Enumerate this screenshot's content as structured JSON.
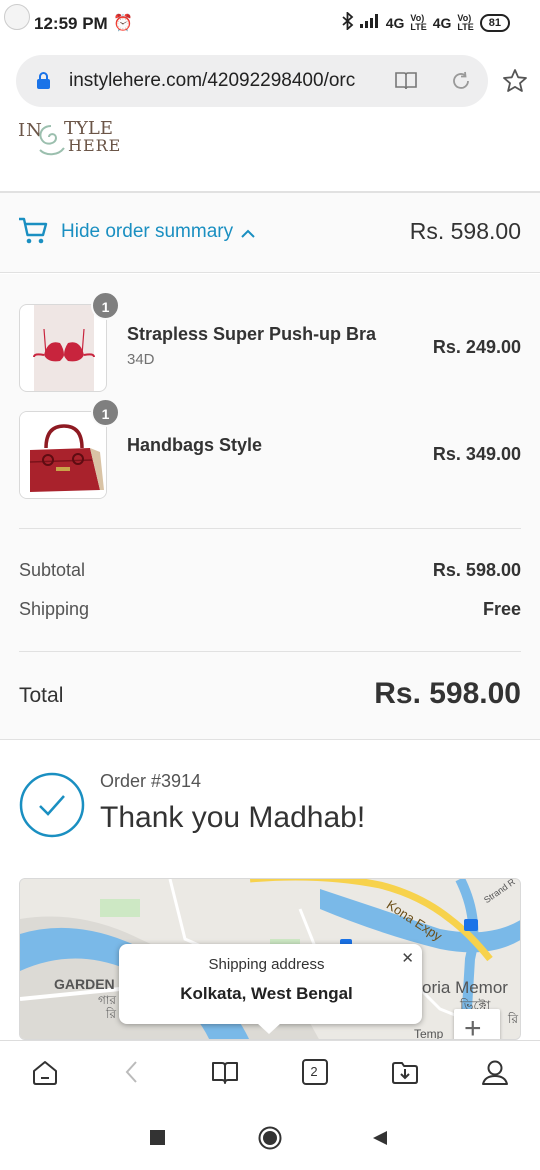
{
  "status_bar": {
    "time": "12:59 PM",
    "network_1": "4G",
    "network_2": "4G",
    "battery": "81"
  },
  "browser": {
    "url": "instylehere.com/42092298400/orc"
  },
  "store": {
    "logo_line1": "IN",
    "logo_line1b": "TYLE",
    "logo_line2": "HERE"
  },
  "order_summary_toggle": {
    "label": "Hide order summary",
    "total": "Rs. 598.00",
    "accent_color": "#1a8fc1"
  },
  "line_items": [
    {
      "name": "Strapless Super Push-up Bra",
      "variant": "34D",
      "price": "Rs. 249.00",
      "quantity": "1"
    },
    {
      "name": "Handbags Style",
      "variant": "",
      "price": "Rs. 349.00",
      "quantity": "1"
    }
  ],
  "totals": {
    "subtotal_label": "Subtotal",
    "subtotal_value": "Rs. 598.00",
    "shipping_label": "Shipping",
    "shipping_value": "Free",
    "total_label": "Total",
    "total_value": "Rs. 598.00"
  },
  "confirmation": {
    "order_number": "Order #3914",
    "thank_you": "Thank you Madhab!"
  },
  "map": {
    "popup_title": "Shipping address",
    "popup_location": "Kolkata, West Bengal",
    "labels": {
      "garden": "GARDEN",
      "garden_local": "গার",
      "garden_local2": "রি",
      "road": "Kona Expy",
      "strand": "Strand R",
      "memorial": "oria Memor",
      "memorial_local": "ভিক্টো",
      "temple": "Temp",
      "temple_local": "রি"
    }
  },
  "bottom_nav": {
    "tabs_count": "2"
  }
}
